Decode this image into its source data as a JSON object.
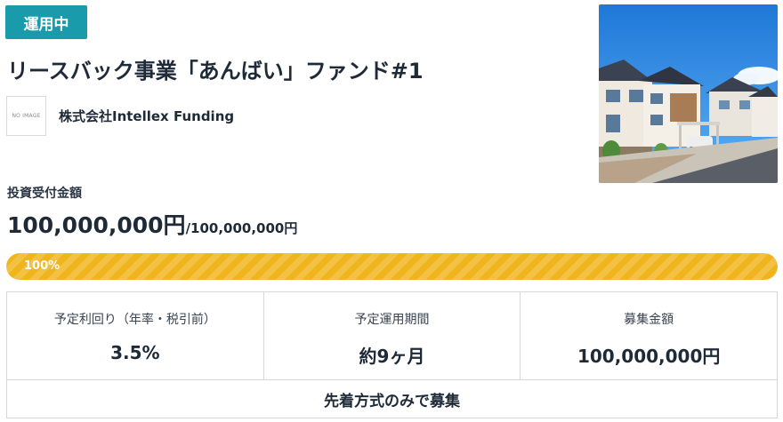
{
  "status": {
    "badge_label": "運用中",
    "color": "#1a9bab"
  },
  "fund": {
    "title": "リースバック事業「あんばい」ファンド#1"
  },
  "company": {
    "logo_placeholder": "NO IMAGE",
    "name": "株式会社Intellex Funding"
  },
  "investment": {
    "label": "投資受付金額",
    "current_amount": "100,000,000円",
    "total_amount": "/100,000,000円",
    "progress_label": "100%",
    "progress_fraction": 1.0,
    "progress_color": "#f0b41c"
  },
  "info": {
    "items": [
      {
        "label": "予定利回り（年率・税引前）",
        "value": "3.5%"
      },
      {
        "label": "予定運用期間",
        "value": "約9ヶ月"
      },
      {
        "label": "募集金額",
        "value": "100,000,000円"
      }
    ],
    "footer": "先着方式のみで募集"
  },
  "image": {
    "subject": "house-photo"
  }
}
